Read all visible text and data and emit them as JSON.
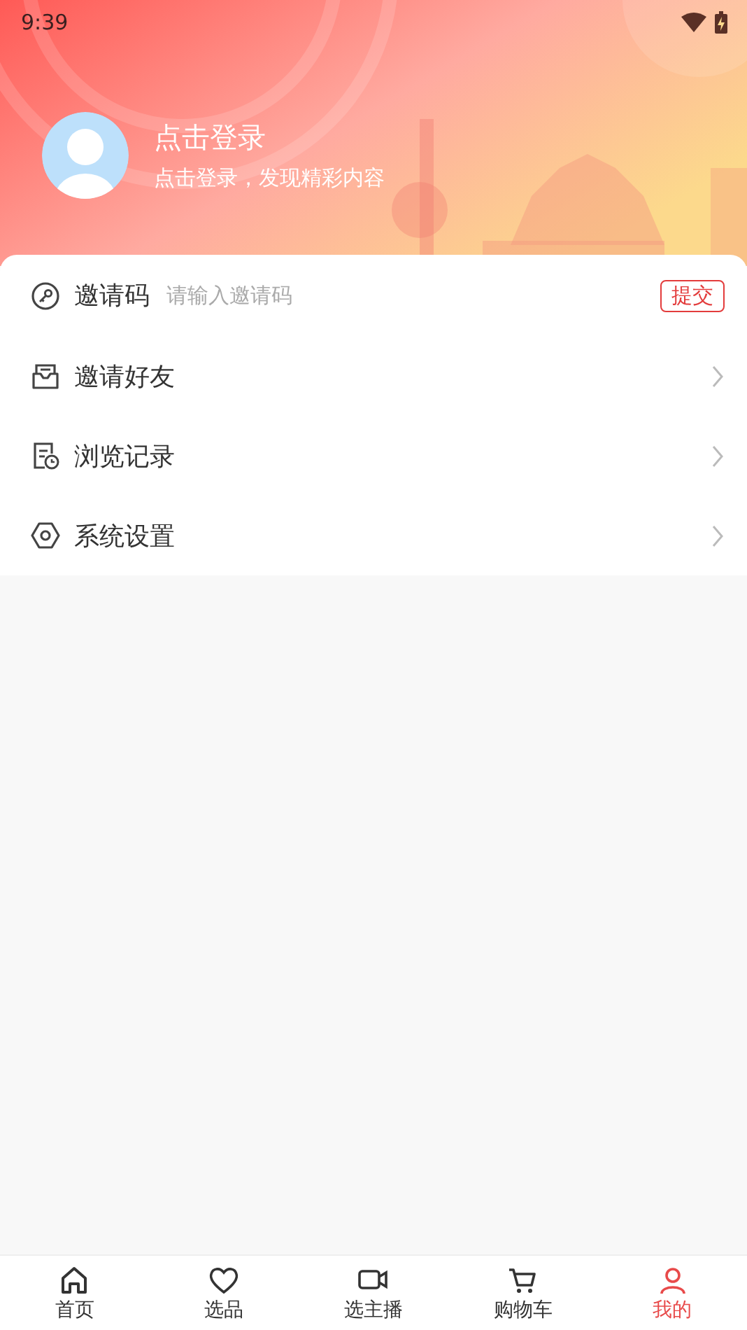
{
  "status_bar": {
    "time": "9:39"
  },
  "profile": {
    "title": "点击登录",
    "subtitle": "点击登录，发现精彩内容"
  },
  "menu": [
    {
      "kind": "input",
      "label": "邀请码",
      "placeholder": "请输入邀请码",
      "button": "提交"
    },
    {
      "kind": "link",
      "label": "邀请好友"
    },
    {
      "kind": "link",
      "label": "浏览记录"
    },
    {
      "kind": "link",
      "label": "系统设置"
    }
  ],
  "tab_bar": [
    {
      "label": "首页",
      "selected": false
    },
    {
      "label": "选品",
      "selected": false
    },
    {
      "label": "选主播",
      "selected": false
    },
    {
      "label": "购物车",
      "selected": false
    },
    {
      "label": "我的",
      "selected": true
    }
  ]
}
